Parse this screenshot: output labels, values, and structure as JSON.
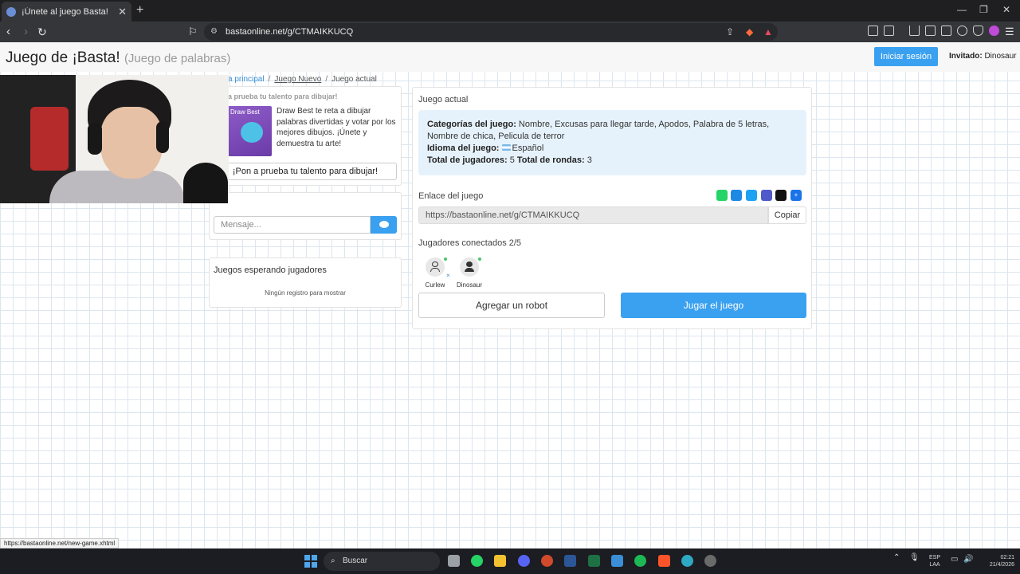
{
  "browser": {
    "tab_title": "¡Únete al juego Basta!",
    "tab_close": "✕",
    "new_tab": "+",
    "url": "bastaonline.net/g/CTMAIKKUCQ",
    "min": "—",
    "restore": "❐",
    "close": "✕"
  },
  "header": {
    "title": "Juego de ¡Basta!",
    "subtitle": "(Juego de palabras)",
    "login_label": "Iniciar sesión",
    "guest_label": "Invitado:",
    "guest_name": "Dinosaur"
  },
  "breadcrumb": {
    "home": "a principal",
    "new_game": "Juego Nuevo",
    "current": "Juego actual",
    "sep": "/"
  },
  "promo": {
    "heading": "a prueba tu talento para dibujar!",
    "image_label": "Draw Best",
    "text": "Draw Best te reta a dibujar palabras divertidas y votar por los mejores dibujos. ¡Únete y demuestra tu arte!",
    "button_label": "¡Pon a prueba tu talento para dibujar!"
  },
  "chat": {
    "placeholder": "Mensaje..."
  },
  "waiting": {
    "title": "Juegos esperando jugadores",
    "empty": "Ningún registro para mostrar"
  },
  "game": {
    "panel_title": "Juego actual",
    "categories_label": "Categorías del juego:",
    "categories": "Nombre, Excusas para llegar tarde, Apodos, Palabra de 5 letras, Nombre de chica, Pelicula de terror",
    "language_label": "Idioma del juego:",
    "language": "Español",
    "players_label": "Total de jugadores:",
    "players": "5",
    "rounds_label": "Total de rondas:",
    "rounds": "3",
    "link_label": "Enlace del juego",
    "link": "https://bastaonline.net/g/CTMAIKKUCQ",
    "copy_label": "Copiar",
    "connected_label": "Jugadores conectados 2/5",
    "player_names": [
      "Curlew",
      "Dinosaur"
    ],
    "remove_mark": "×",
    "robot_label": "Agregar un robot",
    "play_label": "Jugar el juego"
  },
  "share_icons": [
    "whatsapp-icon",
    "messenger-icon",
    "twitter-icon",
    "teams-icon",
    "snapchat-icon",
    "plus-icon"
  ],
  "status_url": "https://bastaonline.net/new-game.xhtml",
  "taskbar": {
    "search_label": "Buscar",
    "lang_top": "ESP",
    "lang_bottom": "LAA",
    "time": "02:21",
    "date": "21/4/2026"
  },
  "colors": {
    "accent": "#3aa0f0",
    "info_bg": "#e6f2fb",
    "online": "#4cc36b"
  }
}
